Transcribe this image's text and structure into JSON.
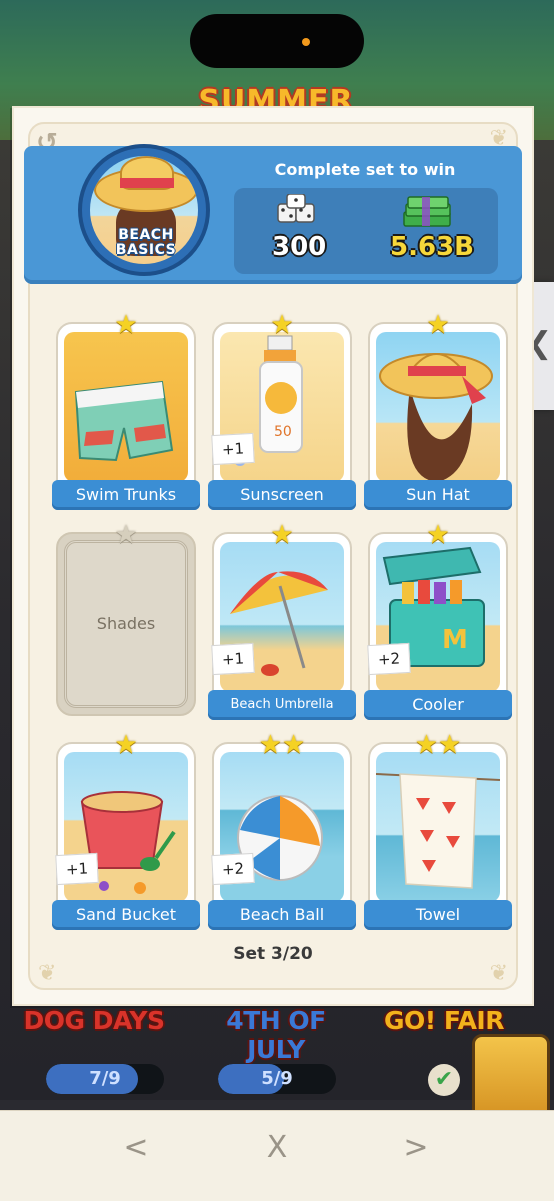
{
  "background": {
    "event_title": "SUMMER",
    "albums": [
      {
        "name": "DOG DAYS",
        "color": "#d9332a",
        "progress_text": "7/9",
        "progress": 0.78
      },
      {
        "name": "4TH OF JULY",
        "color": "#3a79d6",
        "progress_text": "5/9",
        "progress": 0.56
      },
      {
        "name": "GO! FAIR",
        "color": "#f2b21c"
      }
    ],
    "side_tab_icon": "chevron-left-icon"
  },
  "set": {
    "badge_label_line1": "BEACH",
    "badge_label_line2": "BASICS",
    "header_title": "Complete set to win",
    "reward_dice": "300",
    "reward_cash": "5.63B",
    "footer": "Set 3/20"
  },
  "stickers": [
    {
      "name": "Swim Trunks",
      "stars": 1,
      "collected": true,
      "extra": ""
    },
    {
      "name": "Sunscreen",
      "stars": 1,
      "collected": true,
      "extra": "+1"
    },
    {
      "name": "Sun Hat",
      "stars": 1,
      "collected": true,
      "extra": ""
    },
    {
      "name": "Shades",
      "stars": 1,
      "collected": false,
      "extra": ""
    },
    {
      "name": "Beach Umbrella",
      "stars": 1,
      "collected": true,
      "extra": "+1"
    },
    {
      "name": "Cooler",
      "stars": 1,
      "collected": true,
      "extra": "+2"
    },
    {
      "name": "Sand Bucket",
      "stars": 1,
      "collected": true,
      "extra": "+1"
    },
    {
      "name": "Beach Ball",
      "stars": 2,
      "collected": true,
      "extra": "+2"
    },
    {
      "name": "Towel",
      "stars": 2,
      "collected": true,
      "extra": ""
    }
  ],
  "nav": {
    "prev": "<",
    "close": "X",
    "next": ">"
  },
  "colors": {
    "label_blue": "#3b8ed4",
    "header_blue": "#4a97d6",
    "star_gold": "#f5d224"
  }
}
